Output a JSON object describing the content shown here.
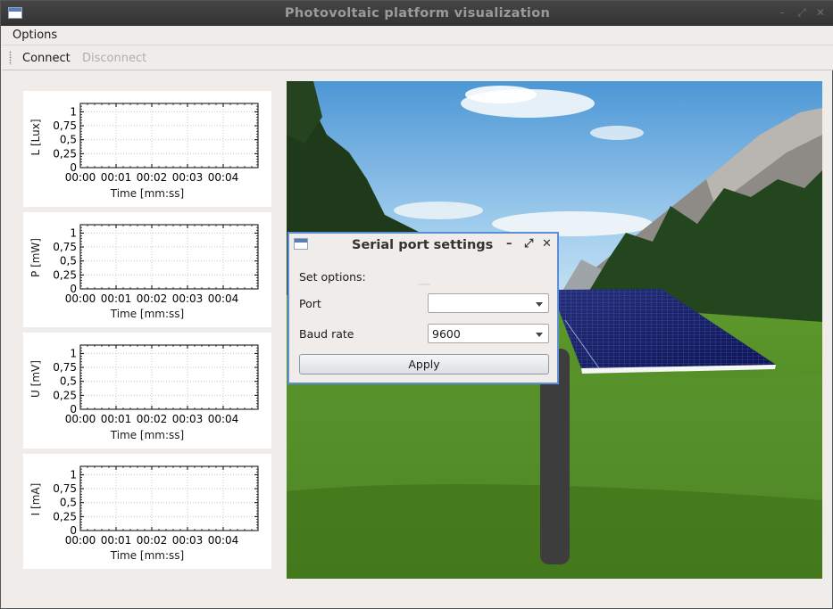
{
  "window": {
    "title": "Photovoltaic platform visualization"
  },
  "menu": {
    "options_label": "Options"
  },
  "toolbar": {
    "connect_label": "Connect",
    "disconnect_label": "Disconnect"
  },
  "plots": [
    {
      "ylabel": "L [Lux]"
    },
    {
      "ylabel": "P [mW]"
    },
    {
      "ylabel": "U [mV]"
    },
    {
      "ylabel": "I [mA]"
    }
  ],
  "plot_common": {
    "xlabel": "Time [mm:ss]",
    "yticks": [
      "0",
      "0,25",
      "0,5",
      "0,75",
      "1"
    ],
    "xticks": [
      "00:00",
      "00:01",
      "00:02",
      "00:03",
      "00:04"
    ]
  },
  "chart_data": [
    {
      "type": "line",
      "ylabel": "L [Lux]",
      "xlabel": "Time [mm:ss]",
      "ylim": [
        0,
        1.15
      ],
      "x": [],
      "y": []
    },
    {
      "type": "line",
      "ylabel": "P [mW]",
      "xlabel": "Time [mm:ss]",
      "ylim": [
        0,
        1.15
      ],
      "x": [],
      "y": []
    },
    {
      "type": "line",
      "ylabel": "U [mV]",
      "xlabel": "Time [mm:ss]",
      "ylim": [
        0,
        1.15
      ],
      "x": [],
      "y": []
    },
    {
      "type": "line",
      "ylabel": "I [mA]",
      "xlabel": "Time [mm:ss]",
      "ylim": [
        0,
        1.15
      ],
      "x": [],
      "y": []
    }
  ],
  "dialog": {
    "title": "Serial port settings",
    "set_options_label": "Set options:",
    "port_label": "Port",
    "port_value": "",
    "baud_label": "Baud rate",
    "baud_value": "9600",
    "apply_label": "Apply"
  },
  "colors": {
    "accent": "#5b8fd6",
    "titlebar": "#3a3a3a",
    "background": "#efecea"
  }
}
